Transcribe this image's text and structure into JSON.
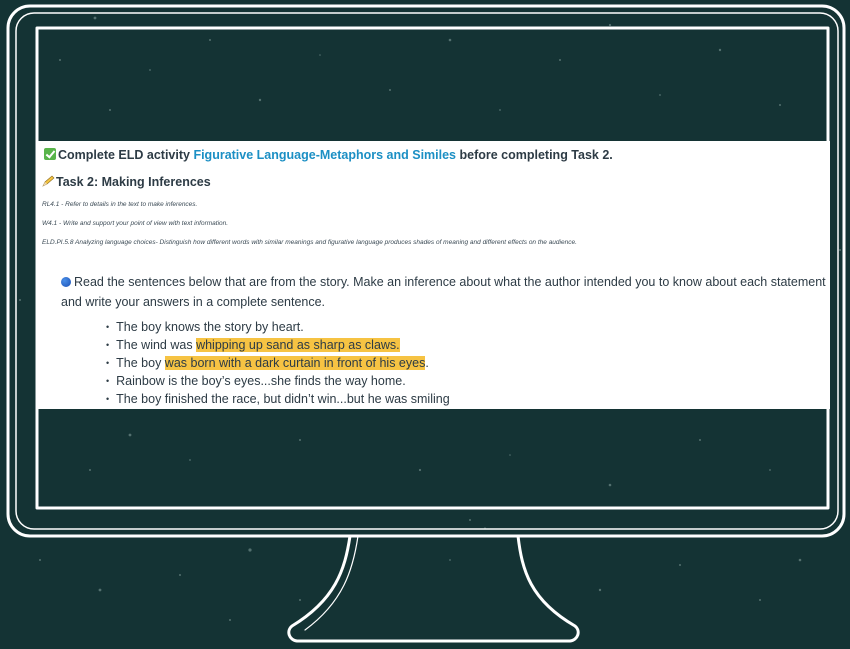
{
  "task_panel": {
    "elds": {
      "prefix": "Complete ELD activity ",
      "link": "Figurative Language-Metaphors and Similes",
      "suffix": " before completing Task 2."
    },
    "task_title": "Task 2: Making Inferences",
    "standards": [
      "RL4.1 - Refer to details in the text to make inferences.",
      "W4.1 - Write and support your point of view with text information.",
      "ELD.PI.5.8 Analyzing language choices- Distinguish how different words with similar meanings and figurative language produces shades of meaning and different effects on the audience."
    ],
    "instructions": "Read the sentences below that are from the story.  Make an inference about what the author intended you to know about each statement and write your answers in a complete sentence.",
    "bullet_char": "•",
    "sentences": [
      {
        "pre": "The boy knows the story by heart.",
        "hl": "",
        "post": ""
      },
      {
        "pre": "The wind was ",
        "hl": "whipping up sand as sharp as claws.",
        "post": ""
      },
      {
        "pre": "The boy ",
        "hl": "was born with a dark curtain in front of his eyes",
        "post": "."
      },
      {
        "pre": "Rainbow is the boy’s eyes...she finds the way home.",
        "hl": "",
        "post": ""
      },
      {
        "pre": "The boy finished the race, but didn’t win...but he was smiling",
        "hl": "",
        "post": ""
      }
    ]
  },
  "colors": {
    "chalkboard": "#143334",
    "link": "#1b8fc4",
    "highlight": "#f6c343",
    "check": "#58b44a"
  },
  "icons": [
    "checkmark-icon",
    "pencil-icon",
    "blue-circle-icon"
  ]
}
